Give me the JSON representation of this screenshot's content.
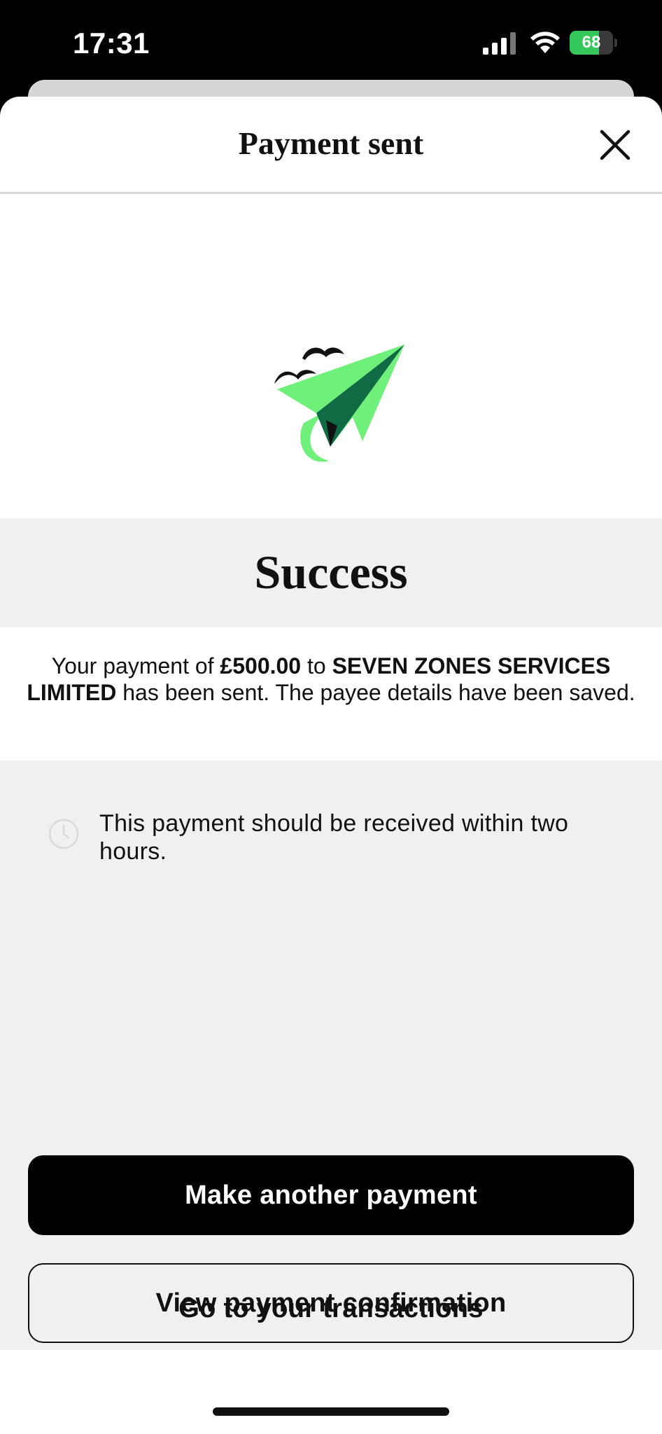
{
  "status_bar": {
    "time": "17:31",
    "battery_level": "68",
    "battery_fraction": 0.68,
    "icons": [
      "signal-icon",
      "wifi-icon",
      "battery-icon"
    ]
  },
  "header": {
    "title": "Payment sent",
    "close_icon": "close-icon"
  },
  "illustration": {
    "icon": "paper-plane-illustration",
    "colors": {
      "light_green": "#6ff07a",
      "dark_green": "#0f6b43",
      "birds": "#111111"
    }
  },
  "success": {
    "heading": "Success"
  },
  "message": {
    "prefix": "Your payment of ",
    "amount": "£500.00",
    "middle": " to ",
    "payee": "SEVEN ZONES SERVICES LIMITED",
    "suffix": " has been sent. The payee details have been saved."
  },
  "info": {
    "icon": "clock-icon",
    "text": "This payment should be received within two hours."
  },
  "actions": {
    "primary_label": "Make another payment",
    "secondary_label": "View payment confirmation",
    "link_label": "Go to your transactions"
  },
  "colors": {
    "primary_button": "#000000",
    "panel_background": "#f0f0f0",
    "battery_green": "#34c759"
  }
}
